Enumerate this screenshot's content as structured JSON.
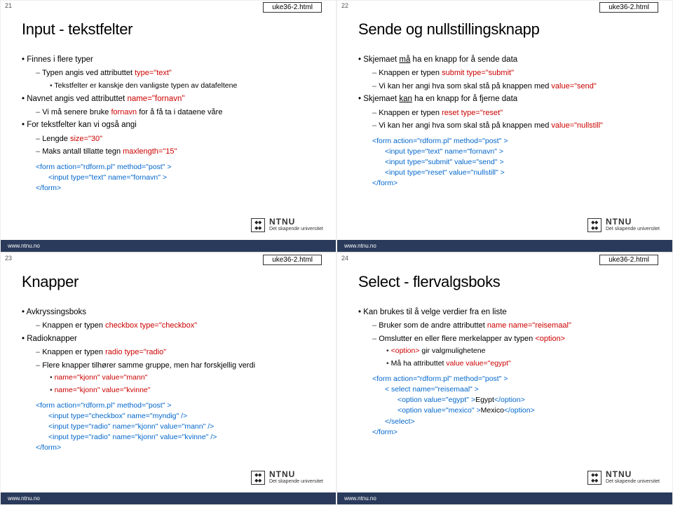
{
  "slides": [
    {
      "num": "21",
      "file": "uke36-2.html",
      "title": "Input - tekstfelter",
      "items": [
        {
          "level": 1,
          "parts": [
            {
              "t": "Finnes i flere typer"
            }
          ]
        },
        {
          "level": 2,
          "parts": [
            {
              "t": "Typen angis ved attributtet      "
            },
            {
              "t": "type=\"text\"",
              "cls": "red"
            }
          ]
        },
        {
          "level": 3,
          "parts": [
            {
              "t": "Tekstfelter er kanskje den vanligste typen av datafeltene"
            }
          ]
        },
        {
          "level": 1,
          "parts": [
            {
              "t": "Navnet angis ved attributtet    "
            },
            {
              "t": "name=\"fornavn\"",
              "cls": "red"
            }
          ]
        },
        {
          "level": 2,
          "parts": [
            {
              "t": "Vi må senere bruke "
            },
            {
              "t": "fornavn",
              "cls": "red"
            },
            {
              "t": " for å få ta i dataene våre"
            }
          ]
        },
        {
          "level": 1,
          "parts": [
            {
              "t": "For tekstfelter kan vi også angi"
            }
          ]
        },
        {
          "level": 2,
          "parts": [
            {
              "t": "Lengde                       "
            },
            {
              "t": "size=\"30\"",
              "cls": "red"
            }
          ]
        },
        {
          "level": 2,
          "parts": [
            {
              "t": "Maks antall tillatte tegn      "
            },
            {
              "t": "maxlength=\"15\"",
              "cls": "red"
            }
          ]
        }
      ],
      "code": [
        {
          "i": 0,
          "parts": [
            {
              "t": "<form action=\"rdform.pl\" method=\"post\" >",
              "cls": "blue"
            }
          ]
        },
        {
          "i": 1,
          "parts": [
            {
              "t": "<input type=\"text\" name=\"fornavn\" >",
              "cls": "blue"
            }
          ]
        },
        {
          "i": 0,
          "parts": [
            {
              "t": "</form>",
              "cls": "blue"
            }
          ]
        }
      ]
    },
    {
      "num": "22",
      "file": "uke36-2.html",
      "title": "Sende og nullstillingsknapp",
      "items": [
        {
          "level": 1,
          "parts": [
            {
              "t": "Skjemaet "
            },
            {
              "t": "må",
              "u": true
            },
            {
              "t": " ha en knapp for å sende data"
            }
          ]
        },
        {
          "level": 2,
          "parts": [
            {
              "t": "Knappen er typen "
            },
            {
              "t": "submit",
              "cls": "red"
            },
            {
              "t": "                            "
            },
            {
              "t": "type=\"submit\"",
              "cls": "red"
            }
          ]
        },
        {
          "level": 2,
          "parts": [
            {
              "t": "Vi kan her angi hva som skal stå på knappen med        "
            },
            {
              "t": "value=\"send\"",
              "cls": "red"
            }
          ]
        },
        {
          "level": 1,
          "parts": [
            {
              "t": "Skjemaet "
            },
            {
              "t": "kan",
              "u": true
            },
            {
              "t": " ha en knapp for å fjerne data"
            }
          ]
        },
        {
          "level": 2,
          "parts": [
            {
              "t": "Knappen er typen "
            },
            {
              "t": "reset",
              "cls": "red"
            },
            {
              "t": "                              "
            },
            {
              "t": "type=\"reset\"",
              "cls": "red"
            }
          ]
        },
        {
          "level": 2,
          "parts": [
            {
              "t": "Vi kan her angi hva som skal stå på knappen med        "
            },
            {
              "t": "value=\"nullstill\"",
              "cls": "red"
            }
          ]
        }
      ],
      "code": [
        {
          "i": 0,
          "parts": [
            {
              "t": "<form action=\"rdform.pl\" method=\"post\" >",
              "cls": "blue"
            }
          ]
        },
        {
          "i": 1,
          "parts": [
            {
              "t": "<input type=\"text\" name=\"fornavn\" >",
              "cls": "blue"
            }
          ]
        },
        {
          "i": 1,
          "parts": [
            {
              "t": "<input type=\"submit\" value=\"send\" >",
              "cls": "blue"
            }
          ]
        },
        {
          "i": 1,
          "parts": [
            {
              "t": "<input type=\"reset\" value=\"nullstill\" >",
              "cls": "blue"
            }
          ]
        },
        {
          "i": 0,
          "parts": [
            {
              "t": "</form>",
              "cls": "blue"
            }
          ]
        }
      ]
    },
    {
      "num": "23",
      "file": "uke36-2.html",
      "title": "Knapper",
      "items": [
        {
          "level": 1,
          "parts": [
            {
              "t": "Avkryssingsboks"
            }
          ]
        },
        {
          "level": 2,
          "parts": [
            {
              "t": "Knappen er typen "
            },
            {
              "t": "checkbox",
              "cls": "red"
            },
            {
              "t": "        "
            },
            {
              "t": "type=\"checkbox\"",
              "cls": "red"
            }
          ]
        },
        {
          "level": 1,
          "parts": [
            {
              "t": "Radioknapper"
            }
          ]
        },
        {
          "level": 2,
          "parts": [
            {
              "t": "Knappen er typen "
            },
            {
              "t": "radio",
              "cls": "red"
            },
            {
              "t": "             "
            },
            {
              "t": "type=\"radio\"",
              "cls": "red"
            }
          ]
        },
        {
          "level": 2,
          "parts": [
            {
              "t": "Flere knapper tilhører samme gruppe, men har forskjellig verdi"
            }
          ]
        },
        {
          "level": 3,
          "parts": [
            {
              "t": "name=\"kjonn\" value=\"mann\"",
              "cls": "red"
            }
          ]
        },
        {
          "level": 3,
          "parts": [
            {
              "t": "name=\"kjonn\" value=\"kvinne\"",
              "cls": "red"
            }
          ]
        }
      ],
      "code": [
        {
          "i": 0,
          "parts": [
            {
              "t": "<form action=\"rdform.pl\" method=\"post\" >",
              "cls": "blue"
            }
          ]
        },
        {
          "i": 1,
          "parts": [
            {
              "t": "<input type=\"checkbox\" name=\"myndig\" />",
              "cls": "blue"
            }
          ]
        },
        {
          "i": 1,
          "parts": [
            {
              "t": "<input type=\"radio\" name=\"kjonn\" value=\"mann\" />",
              "cls": "blue"
            }
          ]
        },
        {
          "i": 1,
          "parts": [
            {
              "t": "<input type=\"radio\" name=\"kjonn\" value=\"kvinne\" />",
              "cls": "blue"
            }
          ]
        },
        {
          "i": 0,
          "parts": [
            {
              "t": "</form>",
              "cls": "blue"
            }
          ]
        }
      ]
    },
    {
      "num": "24",
      "file": "uke36-2.html",
      "title": "Select - flervalgsboks",
      "items": [
        {
          "level": 1,
          "parts": [
            {
              "t": "Kan brukes til å velge verdier fra en liste"
            }
          ]
        },
        {
          "level": 2,
          "parts": [
            {
              "t": "Bruker som de andre attributtet "
            },
            {
              "t": "name",
              "cls": "red"
            },
            {
              "t": "       "
            },
            {
              "t": "name=\"reisemaal\"",
              "cls": "red"
            }
          ]
        },
        {
          "level": 2,
          "parts": [
            {
              "t": "Omslutter en eller flere merkelapper av typen "
            },
            {
              "t": "<option>",
              "cls": "red"
            }
          ]
        },
        {
          "level": 3,
          "parts": [
            {
              "t": "<option>",
              "cls": "red"
            },
            {
              "t": " gir valgmulighetene"
            }
          ]
        },
        {
          "level": 3,
          "parts": [
            {
              "t": "Må ha attributtet                 "
            },
            {
              "t": "value",
              "cls": "red"
            },
            {
              "t": "           "
            },
            {
              "t": "value=\"egypt\"",
              "cls": "red"
            }
          ]
        }
      ],
      "code": [
        {
          "i": 0,
          "parts": [
            {
              "t": "<form action=\"rdform.pl\" method=\"post\" >",
              "cls": "blue"
            }
          ]
        },
        {
          "i": 1,
          "parts": [
            {
              "t": "< select name=\"reisemaal\" >",
              "cls": "blue"
            }
          ]
        },
        {
          "i": 2,
          "parts": [
            {
              "t": "<option value=\"egypt\" >",
              "cls": "blue"
            },
            {
              "t": "Egypt",
              "cls": "blk"
            },
            {
              "t": "</option>",
              "cls": "blue"
            }
          ]
        },
        {
          "i": 2,
          "parts": [
            {
              "t": "<option value=\"mexico\" >",
              "cls": "blue"
            },
            {
              "t": "Mexico",
              "cls": "blk"
            },
            {
              "t": "</option>",
              "cls": "blue"
            }
          ]
        },
        {
          "i": 1,
          "parts": [
            {
              "t": "</select>",
              "cls": "blue"
            }
          ]
        },
        {
          "i": 0,
          "parts": [
            {
              "t": "</form>",
              "cls": "blue"
            }
          ]
        }
      ]
    }
  ],
  "logo": {
    "big": "NTNU",
    "sub": "Det skapende universitet"
  },
  "footer": "www.ntnu.no"
}
